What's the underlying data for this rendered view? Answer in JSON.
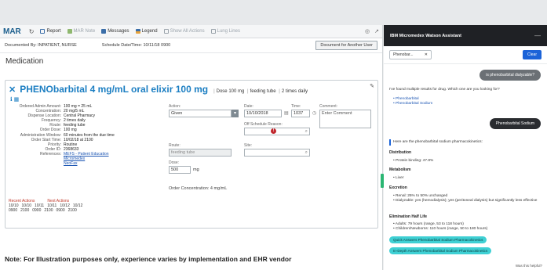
{
  "toolbar": {
    "title": "MAR",
    "items": [
      {
        "label": "Report",
        "enabled": true,
        "icon": "report-icon",
        "color": "#3b6ea8"
      },
      {
        "label": "MAR Note",
        "enabled": false,
        "icon": "note-icon",
        "color": "#8fb86f"
      },
      {
        "label": "Messages",
        "enabled": true,
        "icon": "messages-icon",
        "color": "#3b6ea8"
      },
      {
        "label": "Legend",
        "enabled": true,
        "icon": "legend-icon",
        "color": "#3b6ea8"
      },
      {
        "label": "Show All Actions",
        "enabled": false,
        "icon": "actions-icon",
        "color": "#9aa3ab"
      },
      {
        "label": "Lung Lines",
        "enabled": false,
        "icon": "lines-icon",
        "color": "#9aa3ab"
      }
    ]
  },
  "docbar": {
    "documented_by": "Documented By: INPATIENT, NURSE",
    "schedule": "Schedule Date/Time: 10/11/18 0900",
    "button": "Document for Another User"
  },
  "section_title": "Medication",
  "medication": {
    "name": "PHENObarbital 4 mg/mL oral elixir 100 mg",
    "dose": "Dose 100 mg",
    "route": "feeding tube",
    "frequency": "2 times daily",
    "details": [
      {
        "label": "Ordered Admin Amount:",
        "value": "100 mg = 25 mL"
      },
      {
        "label": "Concentration:",
        "value": "20 mg/5 mL"
      },
      {
        "label": "Dispense Location:",
        "value": "Central Pharmacy"
      },
      {
        "label": "Frequency:",
        "value": "2 times daily"
      },
      {
        "label": "Route:",
        "value": "feeding tube"
      },
      {
        "label": "Order Dose:",
        "value": "100 mg"
      },
      {
        "label": "Administration Window:",
        "value": "60 minutes from the due time"
      },
      {
        "label": "Order Start Time:",
        "value": "10/02/18 at 2100"
      },
      {
        "label": "Priority:",
        "value": "Routine"
      },
      {
        "label": "Order ID:",
        "value": "2368633"
      }
    ],
    "references_label": "References:",
    "references": [
      "MEFS - Patient Education",
      "Micromedex",
      "NeoFax"
    ]
  },
  "recent": {
    "recent_label": "Recent Actions",
    "next_label": "Next Actions",
    "dates": [
      "10/10",
      "10/10",
      "10/11",
      "10/11",
      "10/12",
      "10/12"
    ],
    "times": [
      "0900",
      "2100",
      "0900",
      "2100",
      "0900",
      "2100"
    ]
  },
  "form": {
    "action_label": "Action:",
    "action_value": "Given",
    "date_label": "Date:",
    "date_value": "10/10/2018",
    "time_label": "Time:",
    "time_value": "1037",
    "comment_label": "Comment:",
    "comment_placeholder": "Enter Comment",
    "off_schedule_label": "Off Schedule Reason:",
    "route_label": "Route:",
    "route_value": "feeding tube",
    "site_label": "Site:",
    "dose_label": "Dose:",
    "dose_value": "500",
    "dose_unit": "mg",
    "concentration": "Order Concentration: 4 mg/mL"
  },
  "note": "Note: For Illustration purposes only, experience varies by implementation and EHR vendor",
  "assistant": {
    "title": "IBM Micromedex Watson Assistant",
    "search_chip": "Phenobar...",
    "clear_label": "Clear",
    "question": "is phenobarbital dialyzable?",
    "multi_result": "I've found multiple results for drug. Which one are you looking for?",
    "options": [
      "Phenobarbital",
      "Phenobarbital Sodium"
    ],
    "selection": "Phenobarbital Sodium",
    "intro": "Here are the phenobarbital sodium pharmacokinetics:",
    "sections": [
      {
        "head": "Distribution",
        "items": [
          "Protein binding: 47.8%"
        ]
      },
      {
        "head": "Metabolism",
        "items": [
          "Liver"
        ]
      },
      {
        "head": "Excretion",
        "items": [
          "Renal: 25% to 50% unchanged",
          "Dialyzable: yes (hemodialysis); yes (peritoneal dialysis) but significantly less effective"
        ]
      },
      {
        "head": "Elimination Half Life",
        "items": [
          "Adults: 79 hours (range, 53 to 118 hours)",
          "Children/Newborns: 110 hours (range, 50 to 180 hours)"
        ]
      }
    ],
    "quick_btn": "Quick Answers Phenobarbital Sodium Pharmacokinetics",
    "indepth_btn": "In-Depth Answers Phenobarbital Sodium Pharmacokinetics",
    "footer": "Was this helpful?"
  }
}
